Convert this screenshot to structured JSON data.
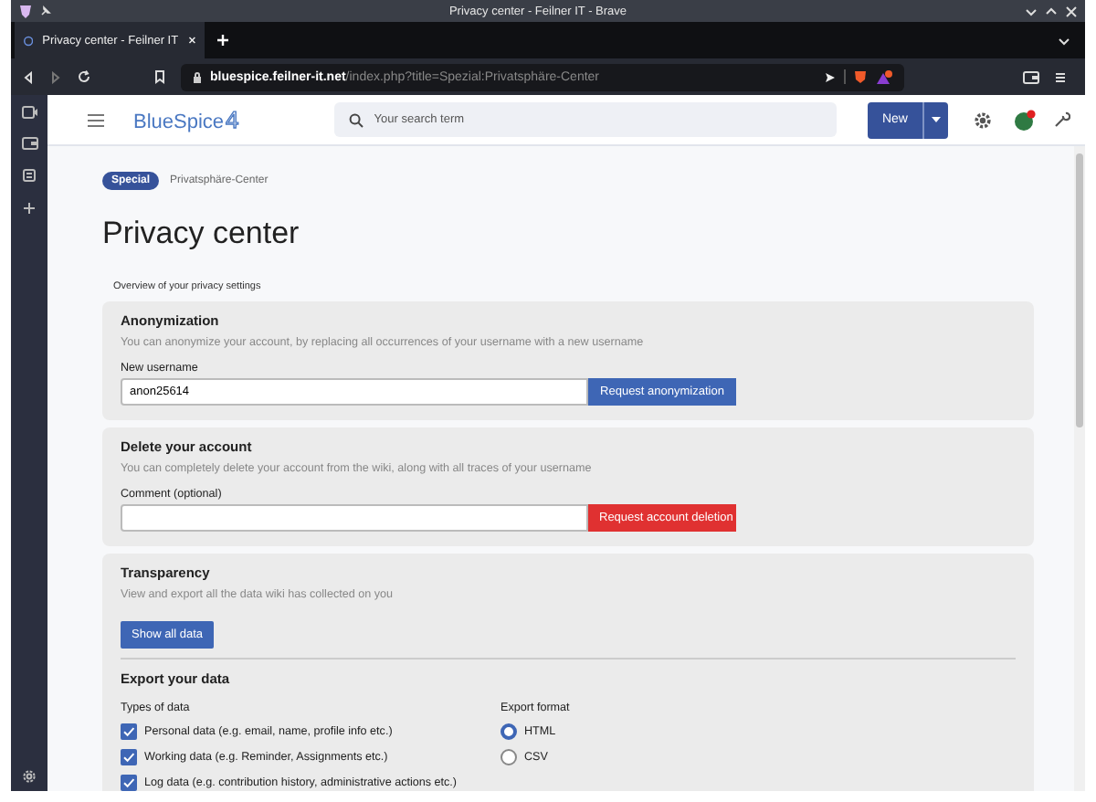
{
  "window": {
    "title": "Privacy center - Feilner IT - Brave"
  },
  "browser": {
    "tabs": [
      {
        "label": "Privacy center - Feilner IT",
        "selected": true
      }
    ],
    "url_host": "bluespice.feilner-it.net",
    "url_path": "/index.php?title=Spezial:Privatsphäre-Center"
  },
  "header": {
    "logo": "BlueSpice",
    "logo_version": "4",
    "search": {
      "placeholder": "Your search term"
    },
    "new_button": "New"
  },
  "breadcrumb": {
    "badge": "Special",
    "page": "Privatsphäre-Center"
  },
  "title": "Privacy center",
  "subtitle": "Overview of your privacy settings",
  "sections": [
    {
      "kind": "anonymize",
      "heading": "Anonymization",
      "description": "You can anonymize your account, by replacing all occurrences of your username with a new username",
      "field_label": "New username",
      "value": "anon25614",
      "button": "Request anonymization"
    },
    {
      "kind": "delete",
      "heading": "Delete your account",
      "description": "You can completely delete your account from the wiki, along with all traces of your username",
      "field_label": "Comment (optional)",
      "button": "Request account deletion"
    },
    {
      "kind": "transparency",
      "heading": "Transparency",
      "description": "View and export all the data wiki has collected on you",
      "button": "Show all data",
      "export": {
        "heading": "Export your data",
        "types_label": "Types of data",
        "types": [
          {
            "label": "Personal data (e.g. email, name, profile info etc.)",
            "checked": true
          },
          {
            "label": "Working data (e.g. Reminder, Assignments etc.)",
            "checked": true
          },
          {
            "label": "Log data (e.g. contribution history, administrative actions etc.)",
            "checked": true
          }
        ],
        "format_label": "Export format",
        "formats": [
          {
            "label": "HTML",
            "selected": true
          },
          {
            "label": "CSV",
            "selected": false
          }
        ]
      }
    }
  ]
}
